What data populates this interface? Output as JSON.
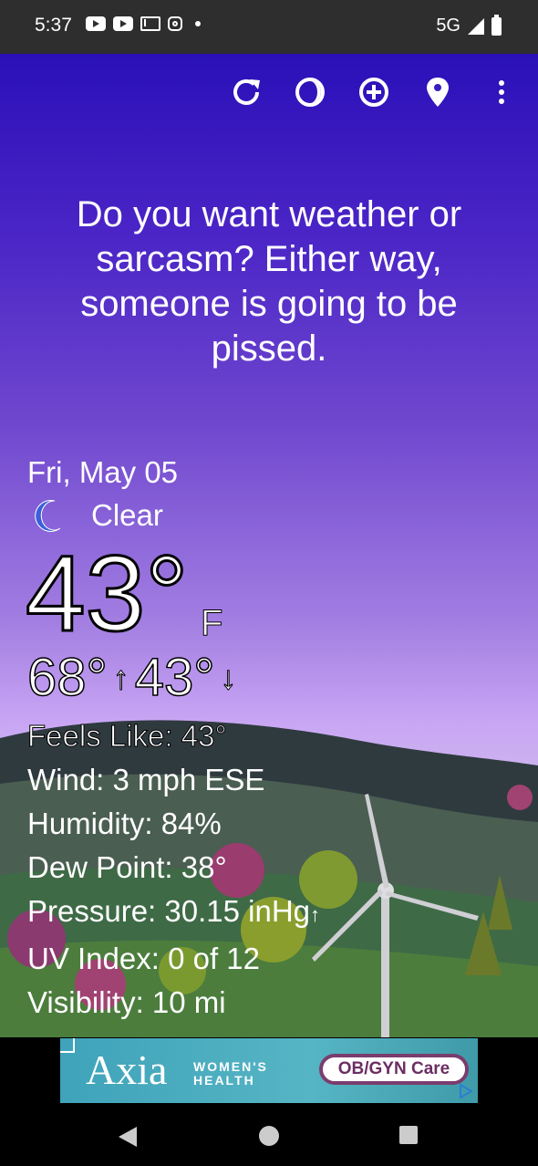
{
  "status_bar": {
    "time": "5:37",
    "network": "5G",
    "icons": [
      "youtube-icon",
      "youtube-icon",
      "gmail-icon",
      "instagram-icon",
      "dot-icon",
      "signal-icon",
      "battery-icon"
    ]
  },
  "toolbar": {
    "icons": [
      "refresh-icon",
      "theme-icon",
      "add-location-icon",
      "location-pin-icon",
      "more-vert-icon"
    ]
  },
  "quote": "Do you want weather or sarcasm? Either way, someone is going to be pissed.",
  "weather": {
    "date": "Fri, May 05",
    "condition": "Clear",
    "condition_icon": "moon-icon",
    "temperature": "43°",
    "unit": "F",
    "high": "68°",
    "low": "43°",
    "details": {
      "feels_like": "Feels Like:  43°",
      "wind": "Wind:  3 mph ESE",
      "humidity": "Humidity:  84%",
      "dew_point": "Dew Point:  38°",
      "pressure": "Pressure:  30.15 inHg",
      "uv_index": "UV Index:  0 of 12",
      "visibility": "Visibility:  10 mi"
    }
  },
  "ad": {
    "brand": "Axia",
    "subtitle_line1": "WOMEN'S",
    "subtitle_line2": "HEALTH",
    "cta": "OB/GYN Care"
  },
  "colors": {
    "sky_top": "#2a10b8",
    "sky_bottom": "#c9a6f4",
    "ad_teal": "#3fa3ba",
    "ad_purple": "#7a3d6e"
  }
}
